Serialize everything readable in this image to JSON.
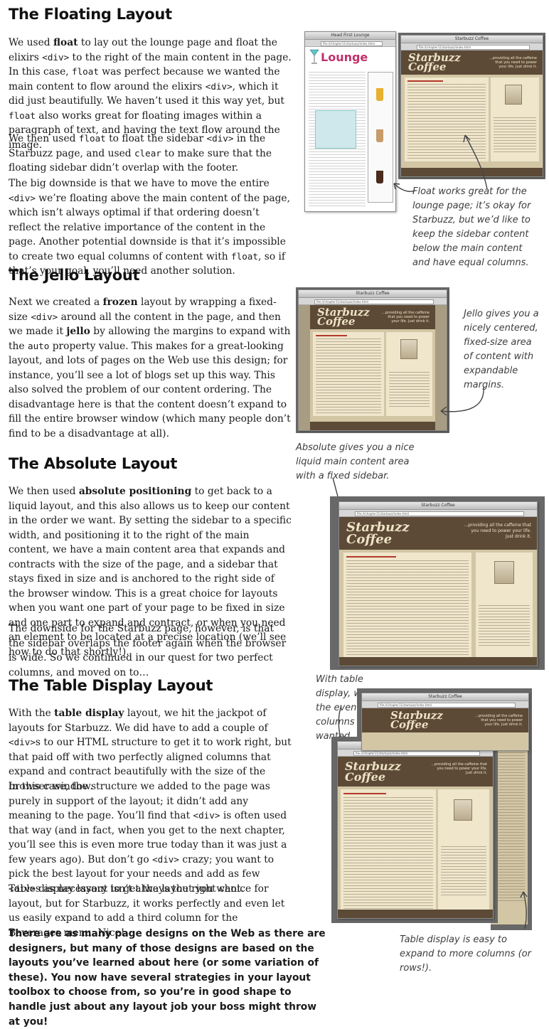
{
  "sections": {
    "floating": {
      "title": "The Floating Layout",
      "p1": [
        {
          "t": "We used "
        },
        {
          "t": "float",
          "b": true
        },
        {
          "t": " to lay out the lounge page and float the elixirs "
        },
        {
          "t": "<div>",
          "c": true
        },
        {
          "t": " to the right of the main content in the page. In this case, "
        },
        {
          "t": "float",
          "c": true
        },
        {
          "t": " was perfect because we wanted the main content to flow around the elixirs "
        },
        {
          "t": "<div>",
          "c": true
        },
        {
          "t": ", which it did just beautifully. We haven’t used it this way yet, but "
        },
        {
          "t": "float",
          "c": true
        },
        {
          "t": " also works great for floating images within a paragraph of text, and having the text flow around the image."
        }
      ],
      "p2": [
        {
          "t": "We then used "
        },
        {
          "t": "float",
          "c": true
        },
        {
          "t": " to float the sidebar "
        },
        {
          "t": "<div>",
          "c": true
        },
        {
          "t": " in the Starbuzz page, and used "
        },
        {
          "t": "clear",
          "c": true
        },
        {
          "t": " to make sure that the floating sidebar didn’t overlap with the footer."
        }
      ],
      "p3": [
        {
          "t": "The big downside is that we have to move the entire "
        },
        {
          "t": "<div>",
          "c": true
        },
        {
          "t": " we’re floating above the main content of the page, which isn’t always optimal if that ordering doesn’t reflect the relative importance of the content in the page. Another potential downside is that it’s impossible to create two equal columns of content with "
        },
        {
          "t": "float",
          "c": true
        },
        {
          "t": ", so if that’s your goal, you’ll need another solution."
        }
      ],
      "note": "Float works great for the lounge page; it’s okay for Starbuzz, but we’d like to keep the sidebar content below the main content and have equal columns."
    },
    "jello": {
      "title": "The Jello Layout",
      "p1": [
        {
          "t": "Next we created a "
        },
        {
          "t": "frozen",
          "b": true
        },
        {
          "t": " layout by wrapping a fixed-size "
        },
        {
          "t": "<div>",
          "c": true
        },
        {
          "t": " around all the content in the page, and then we made it "
        },
        {
          "t": "jello",
          "b": true
        },
        {
          "t": " by allowing the margins to expand with the "
        },
        {
          "t": "auto",
          "c": true
        },
        {
          "t": " property value. This makes for a great-looking layout, and lots of pages on the Web use this design; for instance, you’ll see a lot of blogs set up this way. This also solved the problem of our content ordering. The disadvantage here is that the content doesn’t expand to fill the entire browser window (which many people don’t find to be a disadvantage at all)."
        }
      ],
      "note": "Jello gives you a nicely centered, fixed-size area of content with expandable margins."
    },
    "absolute": {
      "title": "The Absolute Layout",
      "note": "Absolute gives you a nice liquid main content area with a fixed sidebar.",
      "p1": [
        {
          "t": "We then used "
        },
        {
          "t": "absolute positioning",
          "b": true
        },
        {
          "t": " to get back to a liquid layout, and this also allows us to keep our content in the order we want. By setting the sidebar to a specific width, and positioning it to the right of the main content, we have a main content area that expands and contracts with the size of the page, and a sidebar that stays fixed in size and is anchored to the right side of the browser window. This is a great choice for layouts when you want one part of your page to be fixed in size and one part to expand and contract, or when you need an element to be located at a precise location (we’ll see how to do that shortly!)."
        }
      ],
      "p2": [
        {
          "t": "The downside for the Starbuzz page, however, is that the sidebar overlaps the footer again when the browser is wide. So we continued in our quest for two perfect columns, and moved on to…"
        }
      ]
    },
    "table": {
      "title": "The Table Display Layout",
      "note": "With table display, we got the even columns we wanted.",
      "p1": [
        {
          "t": "With the "
        },
        {
          "t": "table display",
          "b": true
        },
        {
          "t": " layout, we hit the jackpot of layouts for Starbuzz. We did have to add a couple of "
        },
        {
          "t": "<div>",
          "c": true
        },
        {
          "t": "s to our HTML structure to get it to work right, but that paid off with two perfectly aligned columns that expand and contract beautifully with the size of the browser window."
        }
      ],
      "p2": [
        {
          "t": "In this case, the structure we added to the page was purely in support of the layout; it didn’t add any meaning to the page. You’ll find that "
        },
        {
          "t": "<div>",
          "c": true
        },
        {
          "t": " is often used that way (and in fact, when you get to the next chapter, you’ll see this is even more true today than it was just a few years ago). But don’t go "
        },
        {
          "t": "<div>",
          "c": true
        },
        {
          "t": " crazy; you want to pick the best layout for your needs and add as few "
        },
        {
          "t": "<div>",
          "c": true
        },
        {
          "t": "s as necessary to get the layout you want."
        }
      ],
      "p3": [
        {
          "t": "Table display layout isn’t always the right choice for layout, but for Starbuzz, it works perfectly and even let us easily expand to add a third column for the Beverages menu. Nice!"
        }
      ],
      "note2": "Table display is easy to expand to more columns (or rows!)."
    }
  },
  "closing": "There are as many page designs on the Web as there are designers, but many of those designs are based on the layouts you’ve learned about here (or some variation of these). You now have several strategies in your layout toolbox to choose from, so you’re in good shape to handle just about any layout job your boss might throw at you!",
  "screenshots": {
    "starbuzz_title": "Starbuzz Coffee",
    "lounge_title": "Head First Lounge",
    "lounge_logo": "Lounge",
    "logo": "Starbuzz Coffee",
    "tagline": "...providing all the caffeine that you need to power your life. Just drink it.",
    "url": "file:///chapter11/starbuzz/index.html"
  },
  "colors": {
    "coffee_dark": "#5c4a36",
    "coffee_light": "#d2c6a5",
    "cream": "#efe6cc",
    "accent_red": "#b43a2a"
  }
}
